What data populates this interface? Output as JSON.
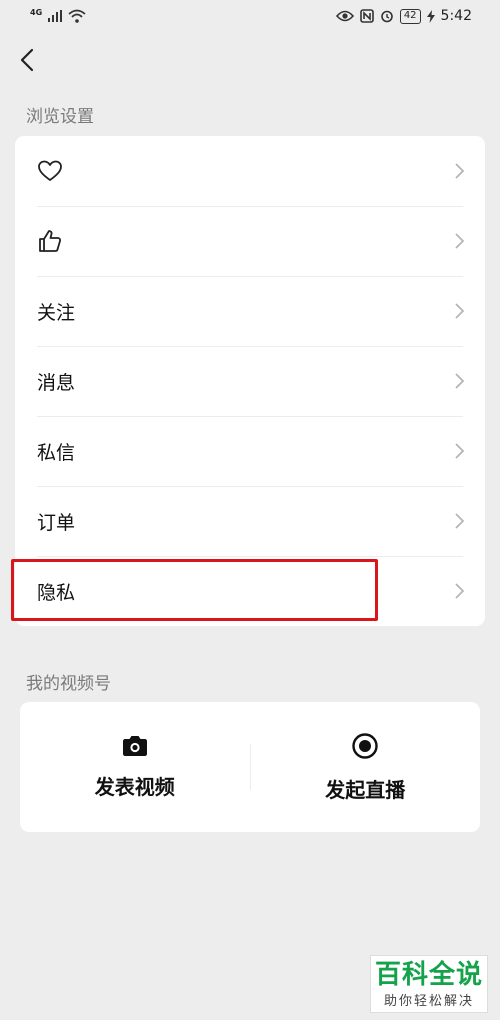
{
  "status_bar": {
    "network": "4G",
    "time": "5:42",
    "battery": "42"
  },
  "browse_section": {
    "title": "浏览设置",
    "items": [
      {
        "label": "",
        "icon": "heart-icon"
      },
      {
        "label": "",
        "icon": "thumbs-up-icon"
      },
      {
        "label": "关注"
      },
      {
        "label": "消息"
      },
      {
        "label": "私信"
      },
      {
        "label": "订单"
      },
      {
        "label": "隐私"
      }
    ]
  },
  "channel_section": {
    "title": "我的视频号",
    "actions": [
      {
        "label": "发表视频",
        "icon": "camera-icon"
      },
      {
        "label": "发起直播",
        "icon": "live-record-icon"
      }
    ]
  },
  "watermark": {
    "title": "百科全说",
    "subtitle": "助你轻松解决"
  },
  "colors": {
    "background": "#ededed",
    "card": "#ffffff",
    "highlight": "#d8161b",
    "watermark_green": "#14a34a"
  }
}
